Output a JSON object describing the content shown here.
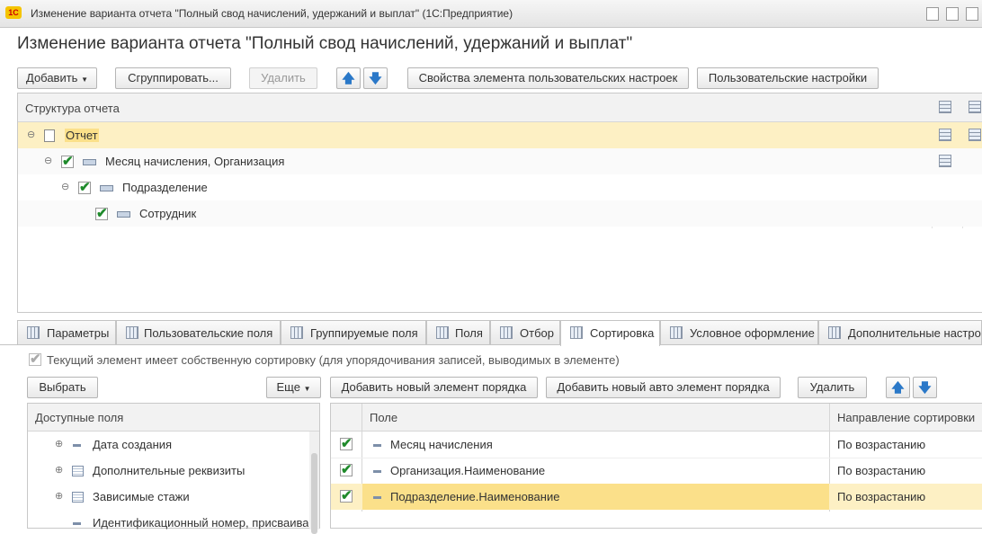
{
  "window": {
    "title": "Изменение варианта отчета \"Полный свод начислений, удержаний и выплат\"  (1С:Предприятие)",
    "logo": "1С"
  },
  "heading": "Изменение варианта отчета \"Полный свод начислений, удержаний и выплат\"",
  "toolbar": {
    "add": "Добавить",
    "group": "Сгруппировать...",
    "delete": "Удалить",
    "props": "Свойства элемента пользовательских настроек",
    "user_settings": "Пользовательские настройки"
  },
  "structure": {
    "header": "Структура отчета",
    "rows": [
      {
        "label": "Отчет"
      },
      {
        "label": "Месяц начисления, Организация"
      },
      {
        "label": "Подразделение"
      },
      {
        "label": "Сотрудник"
      }
    ]
  },
  "tabs": [
    {
      "label": "Параметры"
    },
    {
      "label": "Пользовательские поля"
    },
    {
      "label": "Группируемые поля"
    },
    {
      "label": "Поля"
    },
    {
      "label": "Отбор"
    },
    {
      "label": "Сортировка"
    },
    {
      "label": "Условное оформление"
    },
    {
      "label": "Дополнительные настрой"
    }
  ],
  "sorting": {
    "own_sort_label": "Текущий элемент имеет собственную сортировку (для  упорядочивания записей, выводимых в элементе)",
    "select_btn": "Выбрать",
    "more_btn": "Еще",
    "add_btn": "Добавить новый элемент порядка",
    "add_auto_btn": "Добавить новый авто элемент порядка",
    "delete_btn": "Удалить",
    "available_header": "Доступные поля",
    "available_fields": [
      {
        "label": "Дата создания"
      },
      {
        "label": "Дополнительные реквизиты"
      },
      {
        "label": "Зависимые стажи"
      },
      {
        "label": "Идентификационный номер, присваивае"
      }
    ],
    "col_field": "Поле",
    "col_direction": "Направление сортировки",
    "rows": [
      {
        "field": "Месяц начисления",
        "direction": "По возрастанию"
      },
      {
        "field": "Организация.Наименование",
        "direction": "По возрастанию"
      },
      {
        "field": "Подразделение.Наименование",
        "direction": "По возрастанию"
      }
    ]
  },
  "colors": {
    "selected_row": "#fdf0c4",
    "selected_cell": "#fbe08a",
    "arrow": "#2a78c8"
  }
}
